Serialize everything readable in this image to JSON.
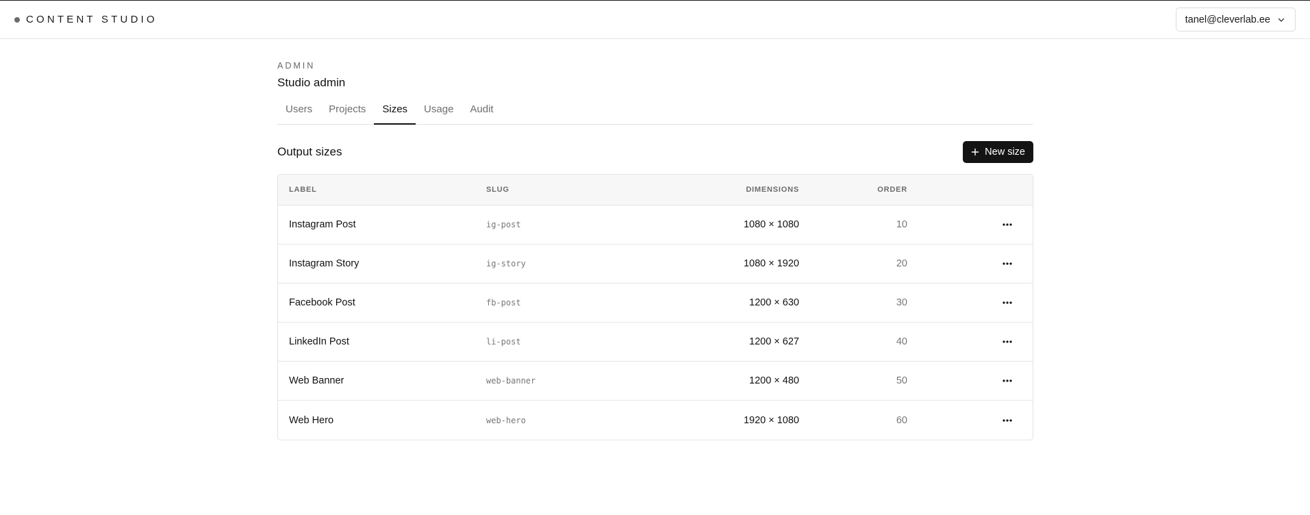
{
  "header": {
    "brand": "CONTENT STUDIO",
    "account_email": "tanel@cleverlab.ee"
  },
  "page": {
    "eyebrow": "ADMIN",
    "title": "Studio admin"
  },
  "tabs": [
    {
      "label": "Users",
      "active": false
    },
    {
      "label": "Projects",
      "active": false
    },
    {
      "label": "Sizes",
      "active": true
    },
    {
      "label": "Usage",
      "active": false
    },
    {
      "label": "Audit",
      "active": false
    }
  ],
  "section": {
    "title": "Output sizes",
    "new_button_label": "New size"
  },
  "table": {
    "columns": {
      "label": "LABEL",
      "slug": "SLUG",
      "dimensions": "DIMENSIONS",
      "order": "ORDER"
    },
    "rows": [
      {
        "label": "Instagram Post",
        "slug": "ig-post",
        "dimensions": "1080 × 1080",
        "order": "10"
      },
      {
        "label": "Instagram Story",
        "slug": "ig-story",
        "dimensions": "1080 × 1920",
        "order": "20"
      },
      {
        "label": "Facebook Post",
        "slug": "fb-post",
        "dimensions": "1200 × 630",
        "order": "30"
      },
      {
        "label": "LinkedIn Post",
        "slug": "li-post",
        "dimensions": "1200 × 627",
        "order": "40"
      },
      {
        "label": "Web Banner",
        "slug": "web-banner",
        "dimensions": "1200 × 480",
        "order": "50"
      },
      {
        "label": "Web Hero",
        "slug": "web-hero",
        "dimensions": "1920 × 1080",
        "order": "60"
      }
    ]
  },
  "icons": {
    "brand": "status-dot-icon",
    "account": "chevron-down-icon",
    "new": "plus-icon",
    "row_actions": "more-horizontal-icon"
  },
  "colors": {
    "primary_button": "#141414",
    "border": "#e2e2e2",
    "header_bg": "#f7f7f7"
  }
}
